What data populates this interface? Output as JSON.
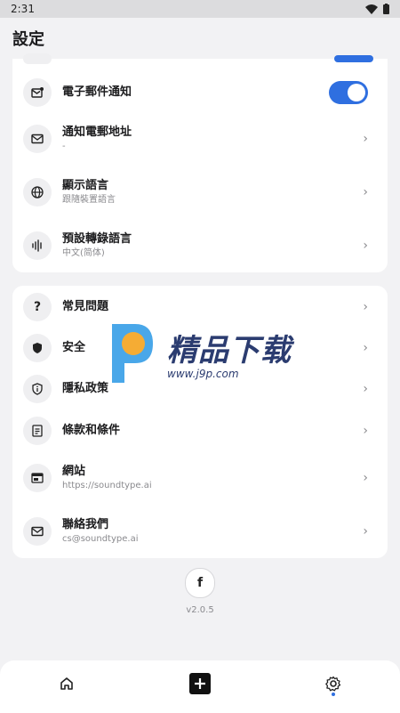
{
  "status_bar": {
    "time": "2:31",
    "icons": [
      "wifi-icon",
      "battery-icon"
    ]
  },
  "header": {
    "title": "設定"
  },
  "notifications_card": {
    "rows": [
      {
        "icon": "mail-dot-icon",
        "title": "電子郵件通知",
        "toggle": true
      },
      {
        "icon": "mail-icon",
        "title": "通知電郵地址",
        "subtitle": "-"
      },
      {
        "icon": "globe-icon",
        "title": "顯示語言",
        "subtitle": "跟隨裝置語言"
      },
      {
        "icon": "waveform-icon",
        "title": "預設轉錄語言",
        "subtitle": "中文(简体)"
      }
    ]
  },
  "info_card": {
    "rows": [
      {
        "icon": "question-icon",
        "title": "常見問題"
      },
      {
        "icon": "shield-icon",
        "title": "安全"
      },
      {
        "icon": "info-shield-icon",
        "title": "隱私政策"
      },
      {
        "icon": "document-icon",
        "title": "條款和條件"
      },
      {
        "icon": "browser-icon",
        "title": "網站",
        "subtitle": "https://soundtype.ai"
      },
      {
        "icon": "mail-icon",
        "title": "聯絡我們",
        "subtitle": "cs@soundtype.ai"
      }
    ]
  },
  "footer": {
    "social": "f",
    "version": "v2.0.5"
  },
  "bottom_nav": {
    "items": [
      "home-icon",
      "add-icon",
      "settings-icon"
    ],
    "active": "settings"
  },
  "watermark": {
    "title": "精品下载",
    "url": "www.j9p.com"
  },
  "colors": {
    "accent": "#2f6fe0",
    "background": "#f2f2f4",
    "card": "#ffffff"
  }
}
